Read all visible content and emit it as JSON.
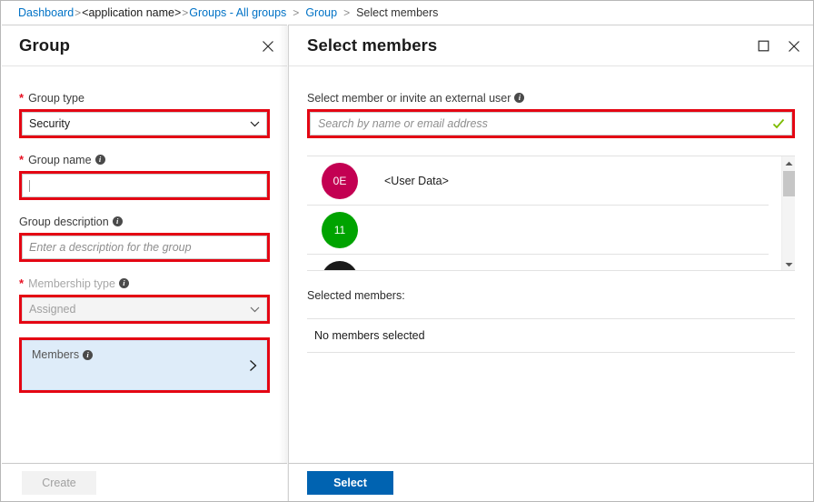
{
  "breadcrumb": {
    "items": [
      {
        "label": "Dashboard",
        "type": "link"
      },
      {
        "label": "<application name>",
        "type": "app"
      },
      {
        "label": "Groups - All groups",
        "type": "link"
      },
      {
        "label": "Group",
        "type": "link"
      },
      {
        "label": "Select members",
        "type": "current"
      }
    ],
    "separator": ">"
  },
  "colors": {
    "accent_blue": "#0072c6",
    "primary_button": "#0063b1",
    "annotation_red": "#e40613",
    "required_red": "#e81123",
    "members_panel_bg": "#deecf9",
    "check_green": "#7cbb00",
    "avatar_crimson": "#c30052",
    "avatar_green": "#00a300",
    "avatar_black": "#1a1a1a"
  },
  "group_blade": {
    "title": "Group",
    "close_icon": "close-icon",
    "group_type": {
      "label": "Group type",
      "required": true,
      "value": "Security",
      "chevron_icon": "chevron-down-icon"
    },
    "group_name": {
      "label": "Group name",
      "required": true,
      "info_icon": "info-icon",
      "value": "",
      "placeholder": ""
    },
    "group_description": {
      "label": "Group description",
      "required": false,
      "info_icon": "info-icon",
      "value": "",
      "placeholder": "Enter a description for the group"
    },
    "membership_type": {
      "label": "Membership type",
      "required": true,
      "info_icon": "info-icon",
      "value": "Assigned",
      "disabled": true,
      "chevron_icon": "chevron-down-icon"
    },
    "members": {
      "label": "Members",
      "info_icon": "info-icon",
      "chevron_icon": "chevron-right-icon"
    },
    "footer": {
      "create_label": "Create",
      "create_disabled": true
    }
  },
  "select_members_blade": {
    "title": "Select members",
    "maximize_icon": "maximize-icon",
    "close_icon": "close-icon",
    "search": {
      "label": "Select member or invite an external user",
      "info_icon": "info-icon",
      "value": "",
      "placeholder": "Search by name or email address",
      "valid_icon": "checkmark-icon"
    },
    "results": {
      "rows": [
        {
          "initials": "0E",
          "color": "#c30052",
          "name": "<User Data>"
        },
        {
          "initials": "11",
          "color": "#00a300",
          "name": ""
        },
        {
          "initials": "",
          "color": "#1a1a1a",
          "name": ""
        }
      ],
      "scrollbar": {
        "up_icon": "caret-up-icon",
        "down_icon": "caret-down-icon",
        "thumb": "scroll-thumb"
      }
    },
    "selected": {
      "heading": "Selected members:",
      "empty_text": "No members selected"
    },
    "footer": {
      "select_label": "Select"
    }
  }
}
